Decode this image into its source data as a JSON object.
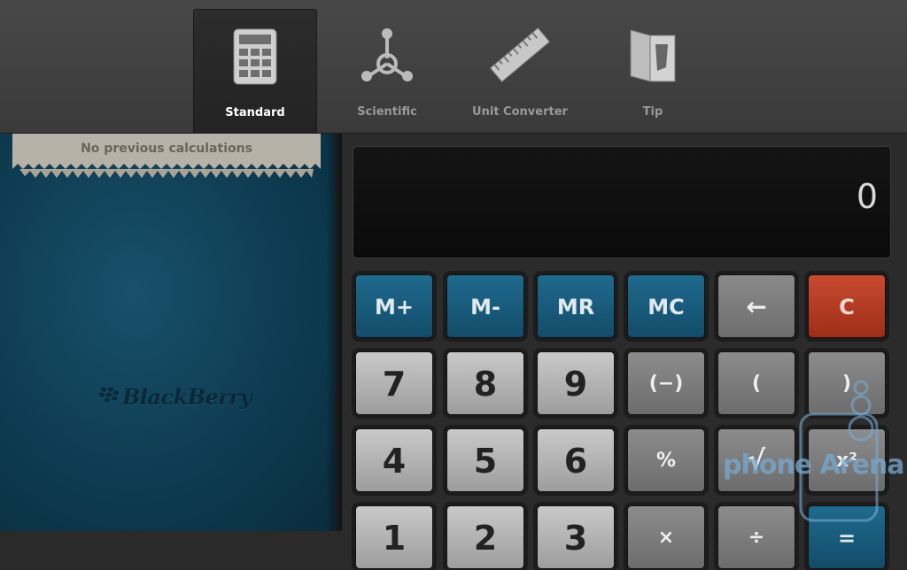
{
  "tabs": [
    {
      "label": "Standard",
      "icon": "calculator-icon",
      "active": true
    },
    {
      "label": "Scientific",
      "icon": "atom-icon",
      "active": false
    },
    {
      "label": "Unit Converter",
      "icon": "ruler-icon",
      "active": false
    },
    {
      "label": "Tip",
      "icon": "menu-card-icon",
      "active": false
    }
  ],
  "history": {
    "empty_text": "No previous calculations"
  },
  "brand": {
    "logo_text": "BlackBerry"
  },
  "display": {
    "value": "0"
  },
  "keys": {
    "row1": [
      "M+",
      "M-",
      "MR",
      "MC",
      "←",
      "C"
    ],
    "row2": [
      "7",
      "8",
      "9",
      "(−)",
      "(",
      ")"
    ],
    "row3": [
      "4",
      "5",
      "6",
      "%",
      "√",
      "x²"
    ],
    "row4": [
      "1",
      "2",
      "3",
      "×",
      "÷",
      "="
    ]
  },
  "watermark": {
    "text": "phone Arena"
  },
  "colors": {
    "memory_key": "#1a5f80",
    "clear_key": "#b33c22",
    "number_key": "#b5b5b5",
    "function_key": "#7c7c7c",
    "panel_blue": "#0e3c52"
  }
}
